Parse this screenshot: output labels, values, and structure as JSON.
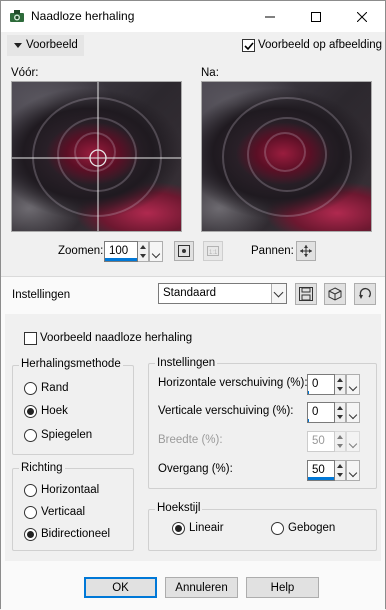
{
  "window": {
    "title": "Naadloze herhaling"
  },
  "preview_section": {
    "toggle_label": "Voorbeeld",
    "on_image_label": "Voorbeeld op afbeelding",
    "on_image_checked": true,
    "before_label": "Vóór:",
    "after_label": "Na:",
    "zoom_label": "Zoomen:",
    "zoom_value": "100",
    "pan_label": "Pannen:"
  },
  "settings_row": {
    "label": "Instellingen",
    "preset_value": "Standaard"
  },
  "seamless_preview": {
    "label": "Voorbeeld naadloze herhaling",
    "checked": false
  },
  "method_group": {
    "title": "Herhalingsmethode",
    "options": [
      "Rand",
      "Hoek",
      "Spiegelen"
    ],
    "selected": "Hoek"
  },
  "direction_group": {
    "title": "Richting",
    "options": [
      "Horizontaal",
      "Verticaal",
      "Bidirectioneel"
    ],
    "selected": "Bidirectioneel"
  },
  "settings_group": {
    "title": "Instellingen",
    "horizontal_label": "Horizontale verschuiving (%):",
    "horizontal_value": "0",
    "vertical_label": "Verticale verschuiving (%):",
    "vertical_value": "0",
    "width_label": "Breedte (%):",
    "width_value": "50",
    "transition_label": "Overgang (%):",
    "transition_value": "50"
  },
  "corner_group": {
    "title": "Hoekstijl",
    "options": [
      "Lineair",
      "Gebogen"
    ],
    "selected": "Lineair"
  },
  "buttons": {
    "ok": "OK",
    "cancel": "Annuleren",
    "help": "Help"
  },
  "colors": {
    "accent": "#0078d7",
    "preview_rose": "#9a1d3e"
  }
}
